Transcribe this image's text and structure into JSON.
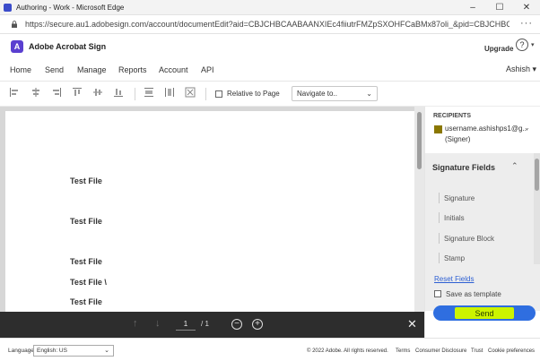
{
  "window": {
    "title": "Authoring - Work - Microsoft Edge",
    "controls": [
      "–",
      "☐",
      "✕"
    ]
  },
  "address": {
    "url": "https://secure.au1.adobesign.com/account/documentEdit?aid=CBJCHBCAABAANXIEc4fiiutrFMZpSXOHFCaBMx87oli_&pid=CBJCHBCAABAA1ViivDf...",
    "more": "···"
  },
  "brand": {
    "name": "Adobe Acrobat Sign",
    "logo": "A",
    "upgrade": "Upgrade",
    "help": "?",
    "caret": "▾"
  },
  "nav": {
    "items": [
      "Home",
      "Send",
      "Manage",
      "Reports",
      "Account",
      "API"
    ],
    "user": "Ashish ▾"
  },
  "toolbar": {
    "relative_label": "Relative to Page",
    "navigate_value": "Navigate to..",
    "dropdown": "⌄"
  },
  "document": {
    "lines": [
      "Test File",
      "Test File",
      "Test File",
      "Test File \\",
      "Test File"
    ]
  },
  "pager": {
    "current": "1",
    "total": "/ 1",
    "up": "↑",
    "down": "↓",
    "zoom_out": "−",
    "zoom_in": "+",
    "close": "✕"
  },
  "recipients": {
    "heading": "RECIPIENTS",
    "email": "username.ashishps1@g...",
    "role": "(Signer)",
    "swatch_color": "#8a7700",
    "chevron": "⌄"
  },
  "fields": {
    "title": "Signature Fields",
    "chevron": "⌃",
    "items": [
      "Signature",
      "Initials",
      "Signature Block",
      "Stamp"
    ]
  },
  "actions": {
    "reset": "Reset Fields",
    "save_template": "Save as template",
    "send": "Send"
  },
  "footer": {
    "language_label": "Language",
    "language_value": "English: US",
    "dropdown": "⌄",
    "copyright": "© 2022 Adobe. All rights reserved.",
    "links": [
      "Terms",
      "Consumer Disclosure",
      "Trust",
      "Cookie preferences"
    ]
  }
}
